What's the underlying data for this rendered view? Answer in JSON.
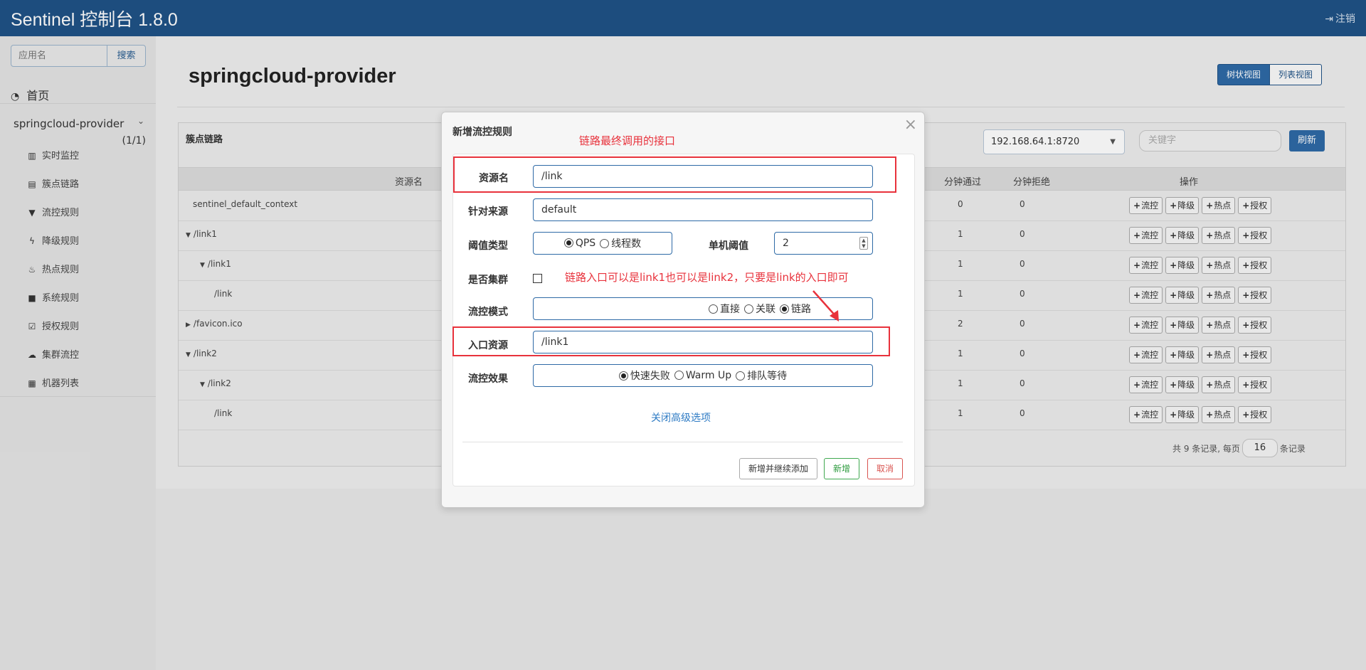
{
  "header": {
    "brand": "Sentinel 控制台 1.8.0",
    "logout": "注销"
  },
  "sidebar": {
    "search_placeholder": "应用名",
    "search_button": "搜索",
    "home": "首页",
    "app_name": "springcloud-provider",
    "app_count": "(1/1)",
    "items": [
      {
        "label": "实时监控",
        "icon": "bar-chart-icon"
      },
      {
        "label": "簇点链路",
        "icon": "list-icon"
      },
      {
        "label": "流控规则",
        "icon": "filter-icon"
      },
      {
        "label": "降级规则",
        "icon": "flash-icon"
      },
      {
        "label": "热点规则",
        "icon": "fire-icon"
      },
      {
        "label": "系统规则",
        "icon": "lock-icon"
      },
      {
        "label": "授权规则",
        "icon": "check-icon"
      },
      {
        "label": "集群流控",
        "icon": "cloud-icon"
      },
      {
        "label": "机器列表",
        "icon": "grid-icon"
      }
    ]
  },
  "main": {
    "title": "springcloud-provider",
    "view_tree": "树状视图",
    "view_list": "列表视图",
    "panel_title": "簇点链路",
    "machine": "192.168.64.1:8720",
    "keyword_placeholder": "关键字",
    "refresh": "刷新",
    "columns": {
      "resource": "资源名",
      "pass": "分钟通过",
      "block": "分钟拒绝",
      "ops": "操作"
    },
    "rows": [
      {
        "name": "sentinel_default_context",
        "prefix": "",
        "pass": "0",
        "block": "0"
      },
      {
        "name": "/link1",
        "prefix": "▼",
        "pass": "1",
        "block": "0"
      },
      {
        "name": "/link1",
        "prefix": "▼",
        "pass": "1",
        "block": "0"
      },
      {
        "name": "/link",
        "prefix": "",
        "pass": "1",
        "block": "0"
      },
      {
        "name": "/favicon.ico",
        "prefix": "▶",
        "pass": "2",
        "block": "0"
      },
      {
        "name": "/link2",
        "prefix": "▼",
        "pass": "1",
        "block": "0"
      },
      {
        "name": "/link2",
        "prefix": "▼",
        "pass": "1",
        "block": "0"
      },
      {
        "name": "/link",
        "prefix": "",
        "pass": "1",
        "block": "0"
      }
    ],
    "ops": {
      "flow": "流控",
      "degrade": "降级",
      "hot": "热点",
      "auth": "授权"
    },
    "pager": {
      "prefix": "共 9 条记录, 每页",
      "size": "16",
      "suffix": "条记录"
    }
  },
  "modal": {
    "title": "新增流控规则",
    "close": "×",
    "labels": {
      "resource": "资源名",
      "limit_app": "针对来源",
      "grade": "阈值类型",
      "count": "单机阈值",
      "cluster": "是否集群",
      "strategy": "流控模式",
      "ref_resource": "入口资源",
      "behavior": "流控效果"
    },
    "values": {
      "resource": "/link",
      "limit_app": "default",
      "count": "2",
      "ref_resource": "/link1"
    },
    "grade_options": [
      {
        "label": "QPS",
        "checked": true
      },
      {
        "label": "线程数",
        "checked": false
      }
    ],
    "strategy_options": [
      {
        "label": "直接",
        "checked": false
      },
      {
        "label": "关联",
        "checked": false
      },
      {
        "label": "链路",
        "checked": true
      }
    ],
    "behavior_options": [
      {
        "label": "快速失败",
        "checked": true
      },
      {
        "label": "Warm Up",
        "checked": false
      },
      {
        "label": "排队等待",
        "checked": false
      }
    ],
    "advanced_link": "关闭高级选项",
    "buttons": {
      "continue": "新增并继续添加",
      "add": "新增",
      "cancel": "取消"
    }
  },
  "annotations": {
    "top": "链路最终调用的接口",
    "middle": "链路入口可以是link1也可以是link2，只要是link的入口即可",
    "color": "#e8323c"
  }
}
